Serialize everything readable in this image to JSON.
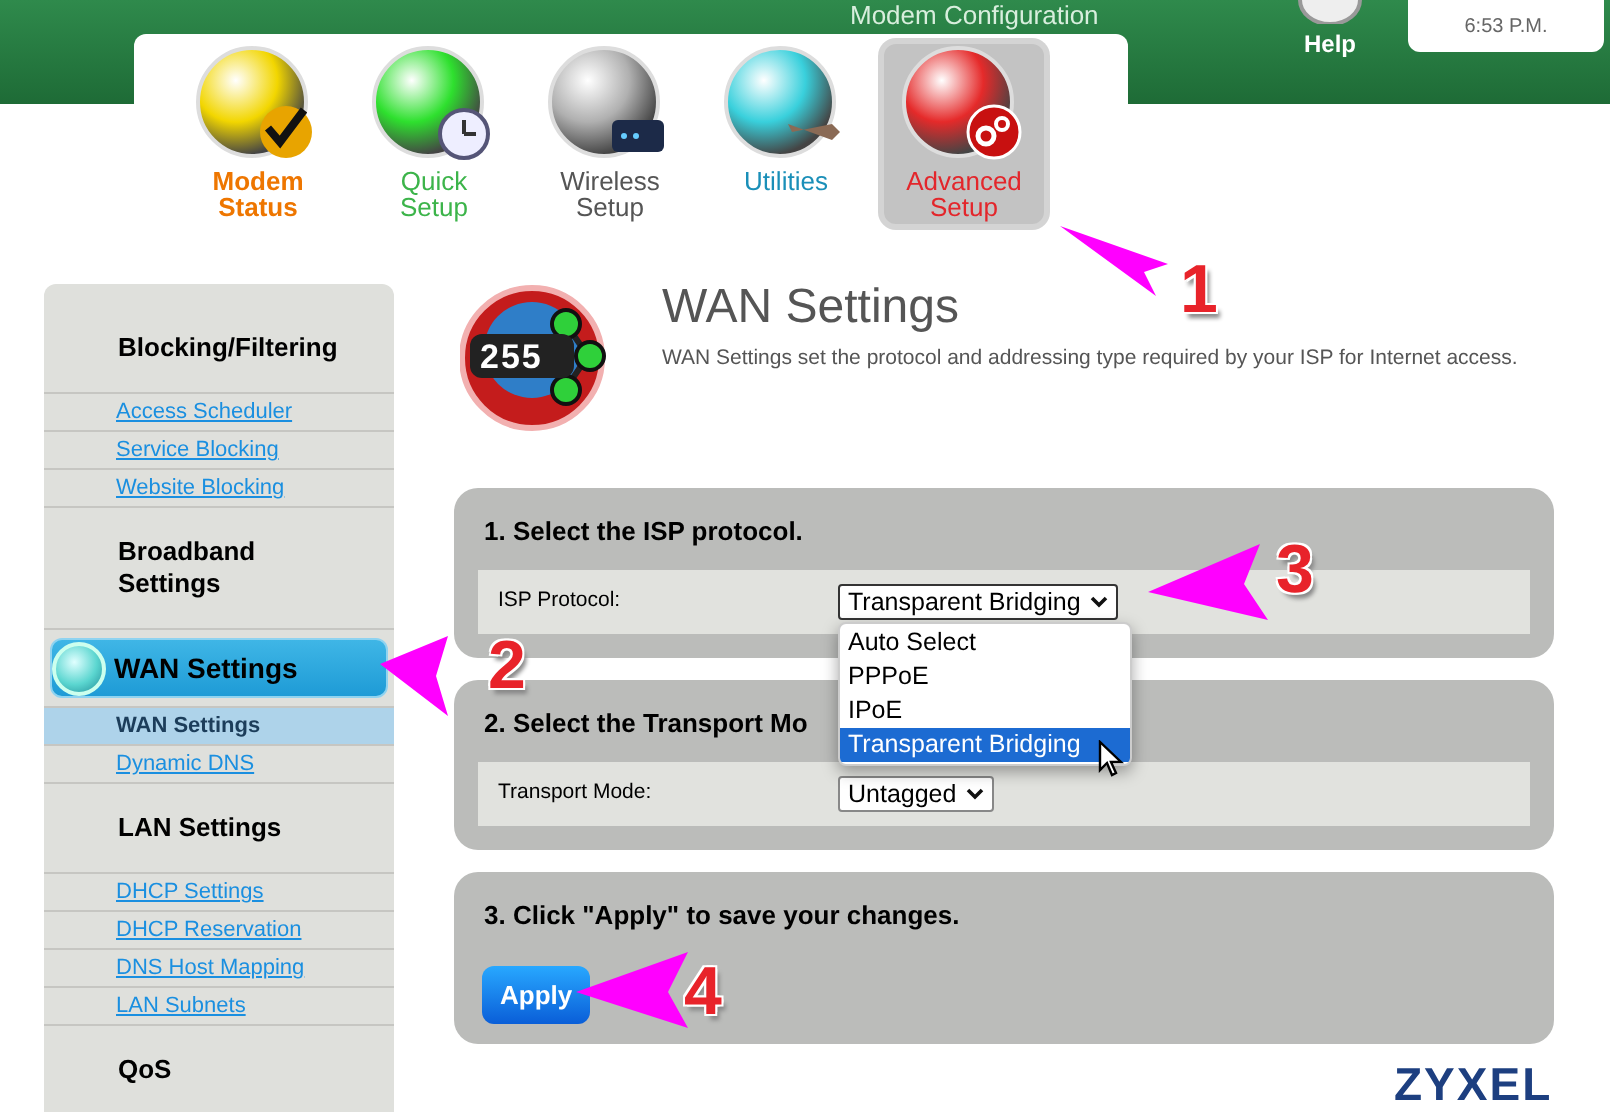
{
  "header": {
    "title": "Modem Configuration",
    "help": "Help",
    "time": "6:53 P.M."
  },
  "nav": [
    {
      "label": "Modem Status",
      "color": "#ee7600",
      "selected": false
    },
    {
      "label": "Quick Setup",
      "color": "#3cb44a",
      "selected": false
    },
    {
      "label": "Wireless Setup",
      "color": "#555555",
      "selected": false
    },
    {
      "label": "Utilities",
      "color": "#1a8fb8",
      "selected": false
    },
    {
      "label": "Advanced Setup",
      "color": "#e3262b",
      "selected": true
    }
  ],
  "sidebar": [
    {
      "kind": "heading",
      "label": "Blocking/Filtering"
    },
    {
      "kind": "link",
      "label": "Access Scheduler",
      "selected": false
    },
    {
      "kind": "link",
      "label": "Service Blocking",
      "selected": false
    },
    {
      "kind": "link",
      "label": "Website Blocking",
      "selected": false
    },
    {
      "kind": "heading",
      "label": "Broadband Settings"
    },
    {
      "kind": "current",
      "label": "WAN Settings"
    },
    {
      "kind": "link",
      "label": "WAN Settings",
      "selected": true
    },
    {
      "kind": "link",
      "label": "Dynamic DNS",
      "selected": false
    },
    {
      "kind": "heading",
      "label": "LAN Settings"
    },
    {
      "kind": "link",
      "label": "DHCP Settings",
      "selected": false
    },
    {
      "kind": "link",
      "label": "DHCP Reservation",
      "selected": false
    },
    {
      "kind": "link",
      "label": "DNS Host Mapping",
      "selected": false
    },
    {
      "kind": "link",
      "label": "LAN Subnets",
      "selected": false
    },
    {
      "kind": "heading",
      "label": "QoS"
    }
  ],
  "page": {
    "badge": "255",
    "title": "WAN Settings",
    "description": "WAN Settings set the protocol and addressing type required by your ISP for Internet access."
  },
  "steps": [
    {
      "heading": "1. Select the ISP protocol.",
      "field_label": "ISP Protocol:",
      "value": "Transparent Bridging",
      "expanded": true,
      "options": [
        {
          "label": "Auto Select",
          "selected": false
        },
        {
          "label": "PPPoE",
          "selected": false
        },
        {
          "label": "IPoE",
          "selected": false
        },
        {
          "label": "Transparent Bridging",
          "selected": true
        }
      ]
    },
    {
      "heading": "2. Select the Transport Mo",
      "field_label": "Transport Mode:",
      "value": "Untagged",
      "expanded": false
    },
    {
      "heading": "3. Click \"Apply\" to save your changes.",
      "button": "Apply"
    }
  ],
  "logo": "ZYXEL",
  "callouts": [
    "1",
    "2",
    "3",
    "4"
  ]
}
